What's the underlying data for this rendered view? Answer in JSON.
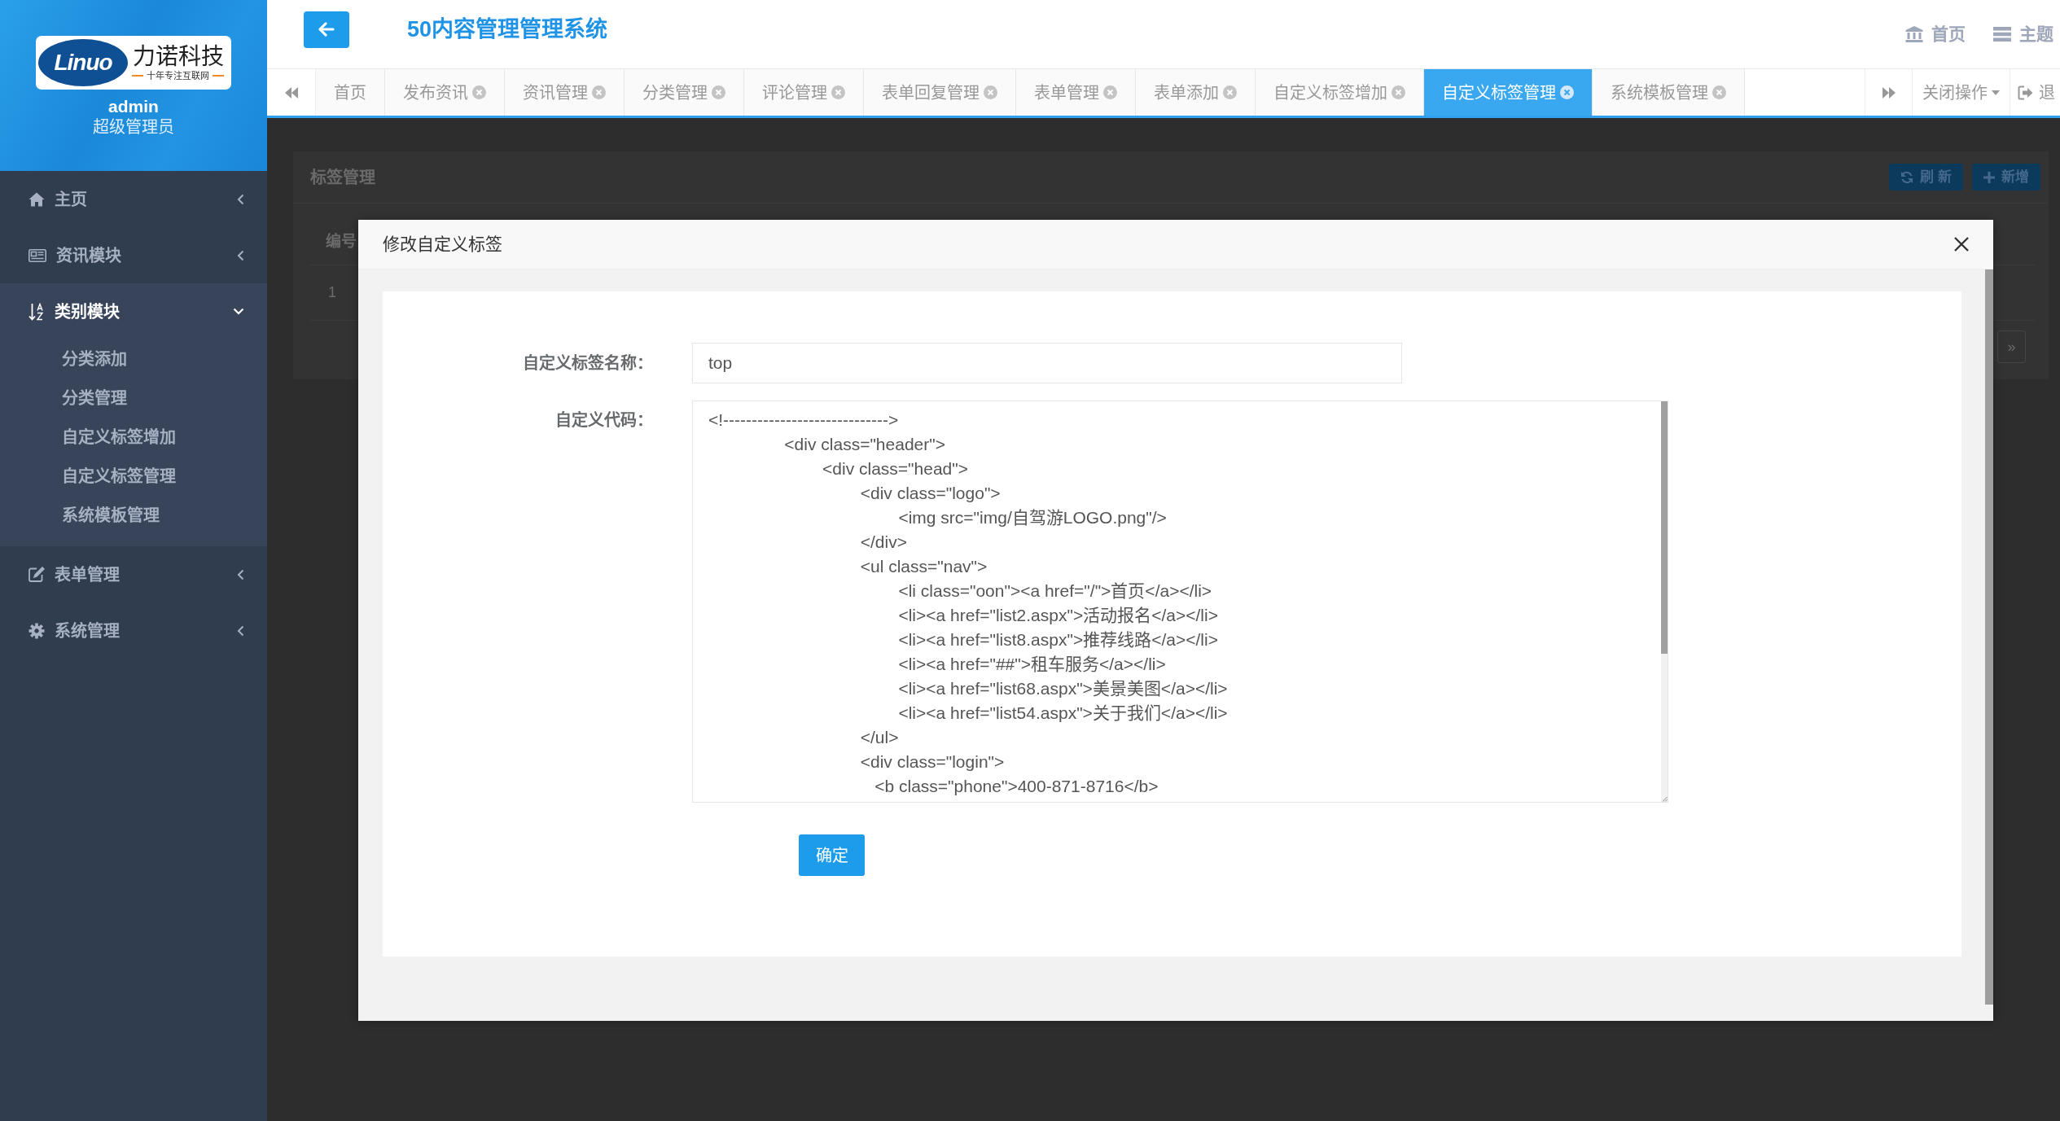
{
  "sidebar": {
    "logo": {
      "emblem": "Linuo",
      "name": "力诺科技",
      "slogan": "十年专注互联网"
    },
    "user": {
      "name": "admin",
      "role": "超级管理员"
    },
    "menu": [
      {
        "label": "主页",
        "expanded": false
      },
      {
        "label": "资讯模块",
        "expanded": false
      },
      {
        "label": "类别模块",
        "expanded": true,
        "children": [
          {
            "label": "分类添加"
          },
          {
            "label": "分类管理"
          },
          {
            "label": "自定义标签增加"
          },
          {
            "label": "自定义标签管理"
          },
          {
            "label": "系统模板管理"
          }
        ]
      },
      {
        "label": "表单管理",
        "expanded": false
      },
      {
        "label": "系统管理",
        "expanded": false
      }
    ]
  },
  "header": {
    "title": "50内容管理管理系统",
    "links": [
      {
        "label": "首页"
      },
      {
        "label": "主题"
      }
    ]
  },
  "tabs": [
    {
      "label": "首页",
      "closable": false,
      "selected": false
    },
    {
      "label": "发布资讯",
      "closable": true,
      "selected": false
    },
    {
      "label": "资讯管理",
      "closable": true,
      "selected": false
    },
    {
      "label": "分类管理",
      "closable": true,
      "selected": false
    },
    {
      "label": "评论管理",
      "closable": true,
      "selected": false
    },
    {
      "label": "表单回复管理",
      "closable": true,
      "selected": false
    },
    {
      "label": "表单管理",
      "closable": true,
      "selected": false
    },
    {
      "label": "表单添加",
      "closable": true,
      "selected": false
    },
    {
      "label": "自定义标签增加",
      "closable": true,
      "selected": false
    },
    {
      "label": "自定义标签管理",
      "closable": true,
      "selected": true
    },
    {
      "label": "系统模板管理",
      "closable": true,
      "selected": false
    }
  ],
  "tab_actions": {
    "close_menu": "关闭操作",
    "logout": "退"
  },
  "page": {
    "title": "标签管理",
    "buttons": [
      {
        "label": "刷 新"
      },
      {
        "label": "新增"
      }
    ],
    "table": {
      "columns": [
        "编号"
      ],
      "rows": [
        [
          "1"
        ]
      ]
    },
    "pager": "»"
  },
  "dialog": {
    "title": "修改自定义标签",
    "fields": [
      {
        "kind": "input",
        "label": "自定义标签名称：",
        "value": "top"
      },
      {
        "kind": "textarea",
        "label": "自定义代码：",
        "value": "<!----------------------------->\n\t\t<div class=\"header\">\n\t\t\t<div class=\"head\">\n\t\t\t\t<div class=\"logo\">\n\t\t\t\t\t<img src=\"img/自驾游LOGO.png\"/>\n\t\t\t\t</div>\n\t\t\t\t<ul class=\"nav\">\n\t\t\t\t\t<li class=\"oon\"><a href=\"/\">首页</a></li>\n\t\t\t\t\t<li><a href=\"list2.aspx\">活动报名</a></li>\n\t\t\t\t\t<li><a href=\"list8.aspx\">推荐线路</a></li>\n\t\t\t\t\t<li><a href=\"##\">租车服务</a></li>\n\t\t\t\t\t<li><a href=\"list68.aspx\">美景美图</a></li>\n\t\t\t\t\t<li><a href=\"list54.aspx\">关于我们</a></li>\n\t\t\t\t</ul>\n\t\t\t\t<div class=\"login\">\n\t\t\t\t   <b class=\"phone\">400-871-8716</b>"
      }
    ],
    "submit": "确定"
  }
}
